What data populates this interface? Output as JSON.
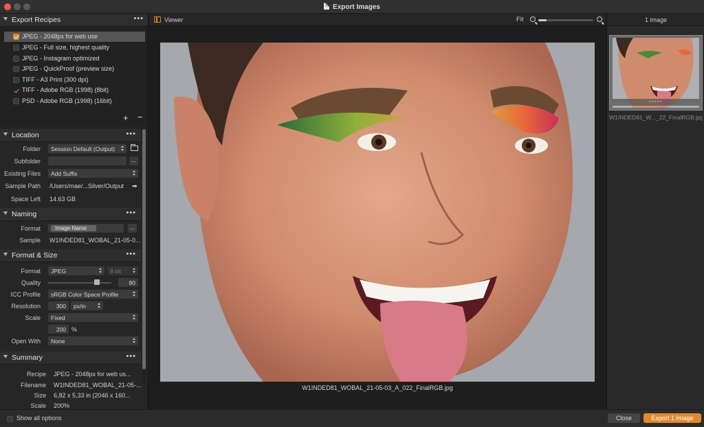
{
  "window": {
    "title": "Export Images"
  },
  "recipes": {
    "title": "Export Recipes",
    "items": [
      {
        "label": "JPEG - 2048px for web use",
        "checked": true
      },
      {
        "label": "JPEG - Full size, highest quality",
        "checked": false
      },
      {
        "label": "JPEG - Instagram optimized",
        "checked": false
      },
      {
        "label": "JPEG - QuickProof (preview size)",
        "checked": false
      },
      {
        "label": "TIFF - A3 Print (300 dpi)",
        "checked": false
      },
      {
        "label": "TIFF - Adobe RGB (1998) (8bit)",
        "checked": true
      },
      {
        "label": "PSD - Adobe RGB (1998) (16bit)",
        "checked": false
      }
    ],
    "add": "+",
    "remove": "−"
  },
  "location": {
    "title": "Location",
    "folder_label": "Folder",
    "folder_value": "Session Default (Output)",
    "subfolder_label": "Subfolder",
    "subfolder_value": "",
    "existing_label": "Existing Files",
    "existing_value": "Add Suffix",
    "sample_label": "Sample Path",
    "sample_value": "/Users/mae/...Silver/Output",
    "space_label": "Space Left",
    "space_value": "14.63 GB"
  },
  "naming": {
    "title": "Naming",
    "format_label": "Format",
    "format_value": "Image Name",
    "sample_label": "Sample",
    "sample_value": "W1INDED81_WOBAL_21-05-0..."
  },
  "format_size": {
    "title": "Format & Size",
    "format_label": "Format",
    "format_value": "JPEG",
    "bit_value": "8 bit",
    "quality_label": "Quality",
    "quality_value": "80",
    "quality_fraction": 0.8,
    "icc_label": "ICC Profile",
    "icc_value": "sRGB Color Space Profile",
    "resolution_label": "Resolution",
    "resolution_value": "300",
    "resolution_unit": "px/in",
    "scale_label": "Scale",
    "scale_value": "Fixed",
    "scale_pct_value": "200",
    "scale_pct_unit": "%",
    "open_label": "Open With",
    "open_value": "None"
  },
  "summary": {
    "title": "Summary",
    "recipe_label": "Recipe",
    "recipe_value": "JPEG - 2048px for web us...",
    "filename_label": "Filename",
    "filename_value": "W1INDED81_WOBAL_21-05-...",
    "size_label": "Size",
    "size_value": "6,82 x 5,33 in (2046 x 160...",
    "scale_label": "Scale",
    "scale_value": "200%"
  },
  "bottom": {
    "show_all": "Show all options",
    "close": "Close",
    "export": "Export 1 Image"
  },
  "viewer": {
    "title": "Viewer",
    "fit": "Fit",
    "zoom_fraction": 0.15,
    "filename": "W1INDED81_WOBAL_21-05-03_A_022_FinalRGB.jpg"
  },
  "browser": {
    "count": "1 image",
    "thumb_name": "W1INDED81_W..._22_FinalRGB.jpg"
  },
  "colors": {
    "accent": "#e28a2a"
  }
}
